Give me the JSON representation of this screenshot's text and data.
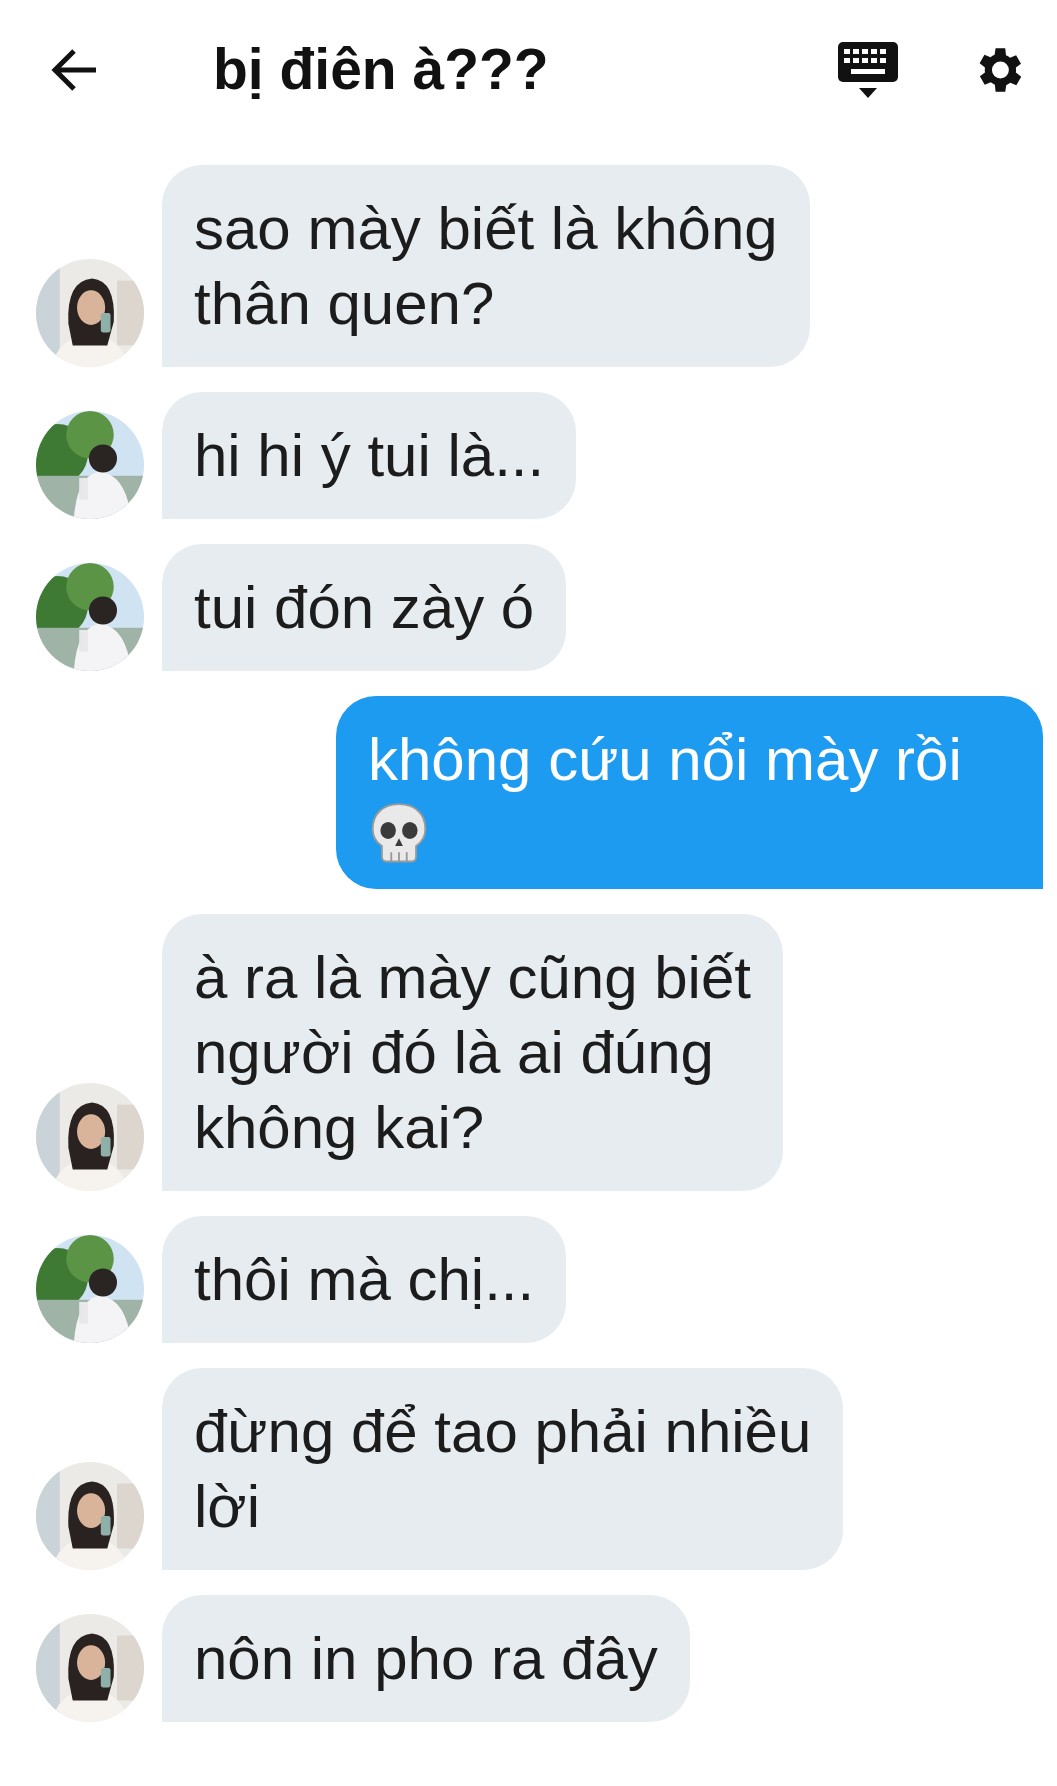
{
  "header": {
    "title": "bị điên à???"
  },
  "messages": [
    {
      "kind": "incoming",
      "text": "sao mày biết là không\nthân quen?",
      "avatar": {
        "kind": "picture",
        "outdoor": false
      }
    },
    {
      "kind": "incoming",
      "text": "hi hi ý tui là...",
      "avatar": {
        "kind": "picture",
        "outdoor": true
      }
    },
    {
      "kind": "incoming",
      "text": "tui đón zày ó",
      "avatar": {
        "kind": "picture",
        "outdoor": true
      }
    },
    {
      "kind": "outgoing",
      "text": "không cứu nổi mày rồi",
      "emoji": true
    },
    {
      "kind": "incoming",
      "text": "à ra là mày cũng biết\nngười đó là ai đúng\nkhông kai?",
      "avatar": {
        "kind": "picture",
        "outdoor": false
      }
    },
    {
      "kind": "incoming",
      "text": "thôi mà chị...",
      "avatar": {
        "kind": "picture",
        "outdoor": true
      }
    },
    {
      "kind": "incoming",
      "text": "đừng để tao phải nhiều\nlời",
      "avatar": {
        "kind": "picture",
        "outdoor": false
      }
    },
    {
      "kind": "incoming",
      "text": "nôn in pho ra đây",
      "avatar": {
        "kind": "picture",
        "outdoor": false
      }
    }
  ]
}
